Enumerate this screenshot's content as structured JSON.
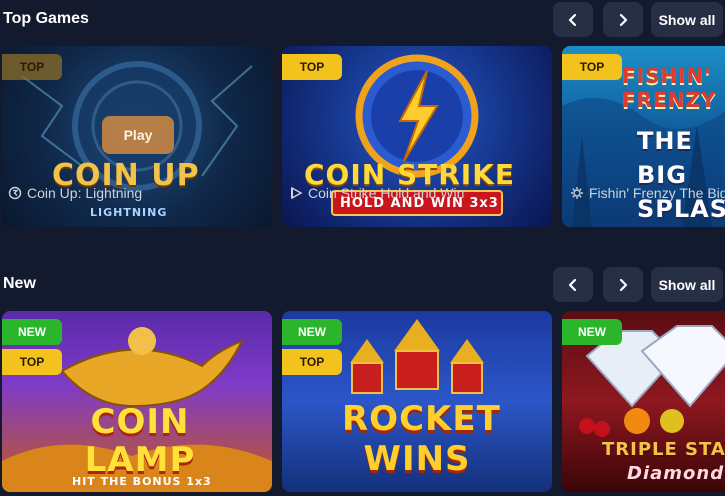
{
  "sections": {
    "top": {
      "title": "Top Games",
      "show_all": "Show all",
      "cards": [
        {
          "badge": "TOP",
          "caption": "Coin Up: Lightning",
          "play": "Play",
          "art_text": "COIN UP",
          "art_sub": "LIGHTNING"
        },
        {
          "badge": "TOP",
          "caption": "Coin Strike Hold and Win",
          "art_text": "COIN STRIKE",
          "art_sub": "HOLD AND WIN 3x3"
        },
        {
          "badge": "TOP",
          "caption": "Fishin' Frenzy The Big Splash",
          "art_text": "FISHIN' FRENZY",
          "art_sub": "THE BIG SPLASH"
        }
      ]
    },
    "new": {
      "title": "New",
      "show_all": "Show all",
      "cards": [
        {
          "badge_new": "NEW",
          "badge_top": "TOP",
          "art_text": "COIN LAMP",
          "art_sub": "HIT THE BONUS 1x3"
        },
        {
          "badge_new": "NEW",
          "badge_top": "TOP",
          "art_text": "ROCKET WINS"
        },
        {
          "badge_new": "NEW",
          "art_text": "TRIPLE STAR",
          "art_sub": "Diamond"
        }
      ]
    }
  },
  "icons": {
    "prev": "chevron-left-icon",
    "next": "chevron-right-icon",
    "provider1": "provider-logo-icon",
    "provider2": "play-triangle-icon",
    "provider3": "gear-icon"
  },
  "colors": {
    "background": "#141a2e",
    "button": "#272f45",
    "badge_top": "#f4c21c",
    "badge_new": "#2bb52b"
  }
}
